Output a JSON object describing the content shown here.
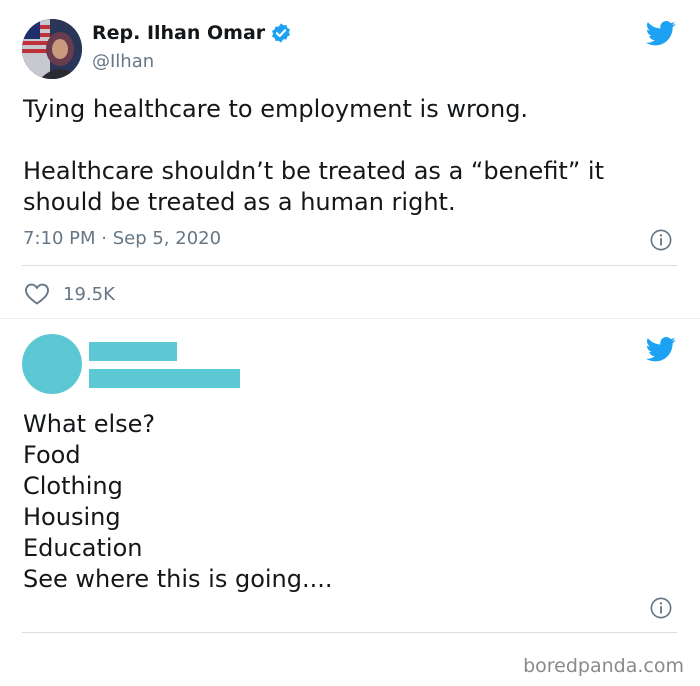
{
  "tweet1": {
    "author_name": "Rep. Ilhan Omar",
    "author_handle": "@Ilhan",
    "text": "Tying healthcare to employment is wrong.\n\nHealthcare shouldn’t be treated as a “benefit” it should be treated as a human right.",
    "timestamp": "7:10 PM · Sep 5, 2020",
    "like_count": "19.5K"
  },
  "tweet2": {
    "text": "What else?\nFood\nClothing\nHousing\nEducation\nSee where this is going...."
  },
  "watermark": "boredpanda.com",
  "colors": {
    "twitter_blue": "#1da1f2",
    "redaction": "#5bc8d3",
    "secondary_text": "#657786"
  }
}
